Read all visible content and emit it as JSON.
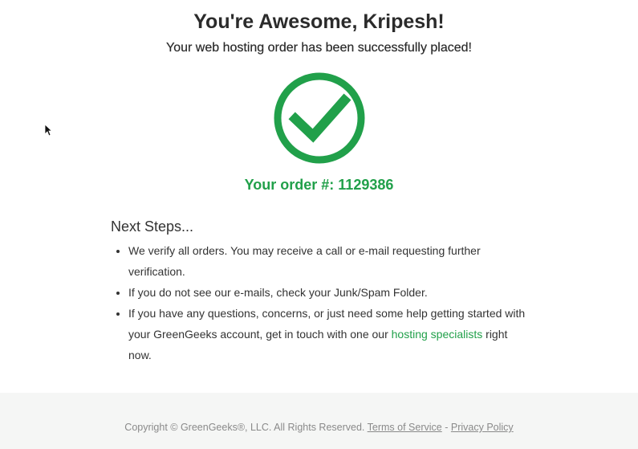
{
  "header": {
    "title": "You're Awesome, Kripesh!",
    "subtitle": "Your web hosting order has been successfully placed!"
  },
  "confirmation": {
    "icon": "checkmark-circle-icon",
    "order_label": "Your order #: 1129386",
    "accent_color": "#21a04a"
  },
  "next_steps": {
    "heading": "Next Steps...",
    "items": [
      {
        "text": "We verify all orders. You may receive a call or e-mail requesting further verification."
      },
      {
        "text": "If you do not see our e-mails, check your Junk/Spam Folder."
      },
      {
        "text_before": "If you have any questions, concerns, or just need some help getting started with your GreenGeeks account, get in touch with one our ",
        "link_text": "hosting specialists",
        "text_after": " right now."
      }
    ]
  },
  "footer": {
    "copyright": "Copyright © GreenGeeks®, LLC. All Rights Reserved.",
    "terms_link": "Terms of Service",
    "separator": "-",
    "privacy_link": "Privacy Policy"
  }
}
